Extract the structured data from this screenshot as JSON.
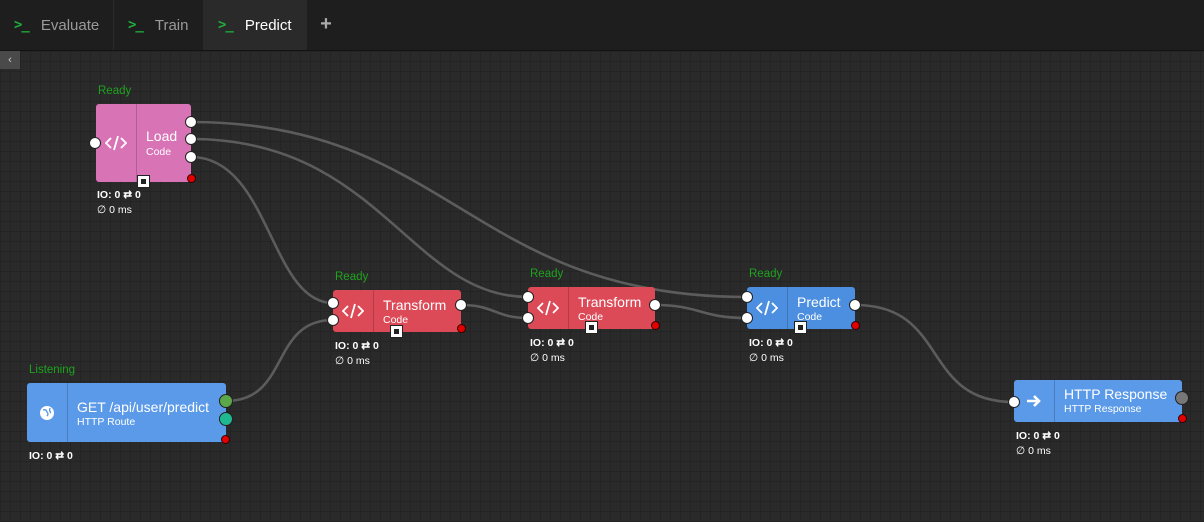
{
  "tabs": [
    {
      "label": "Evaluate",
      "icon": "terminal-icon"
    },
    {
      "label": "Train",
      "icon": "terminal-icon"
    },
    {
      "label": "Predict",
      "icon": "terminal-icon",
      "active": true
    }
  ],
  "add_tab_label": "+",
  "collapse_label": "‹",
  "colors": {
    "code_pink": "#d873b6",
    "code_red": "#dc4a57",
    "code_blue": "#4c8fe0",
    "route_blue": "#5a9ae8",
    "status_green": "#1fa31f"
  },
  "nodes": {
    "load": {
      "status": "Ready",
      "title": "Load",
      "subtitle": "Code",
      "io": "IO: 0 ⇄ 0",
      "time": "∅ 0 ms"
    },
    "transform1": {
      "status": "Ready",
      "title": "Transform",
      "subtitle": "Code",
      "io": "IO: 0 ⇄ 0",
      "time": "∅ 0 ms"
    },
    "transform2": {
      "status": "Ready",
      "title": "Transform",
      "subtitle": "Code",
      "io": "IO: 0 ⇄ 0",
      "time": "∅ 0 ms"
    },
    "predict": {
      "status": "Ready",
      "title": "Predict",
      "subtitle": "Code",
      "io": "IO: 0 ⇄ 0",
      "time": "∅ 0 ms"
    },
    "route": {
      "status": "Listening",
      "title": "GET /api/user/predict",
      "subtitle": "HTTP Route",
      "io": "IO: 0 ⇄ 0"
    },
    "response": {
      "title": "HTTP Response",
      "subtitle": "HTTP Response",
      "io": "IO: 0 ⇄ 0",
      "time": "∅ 0 ms"
    }
  }
}
